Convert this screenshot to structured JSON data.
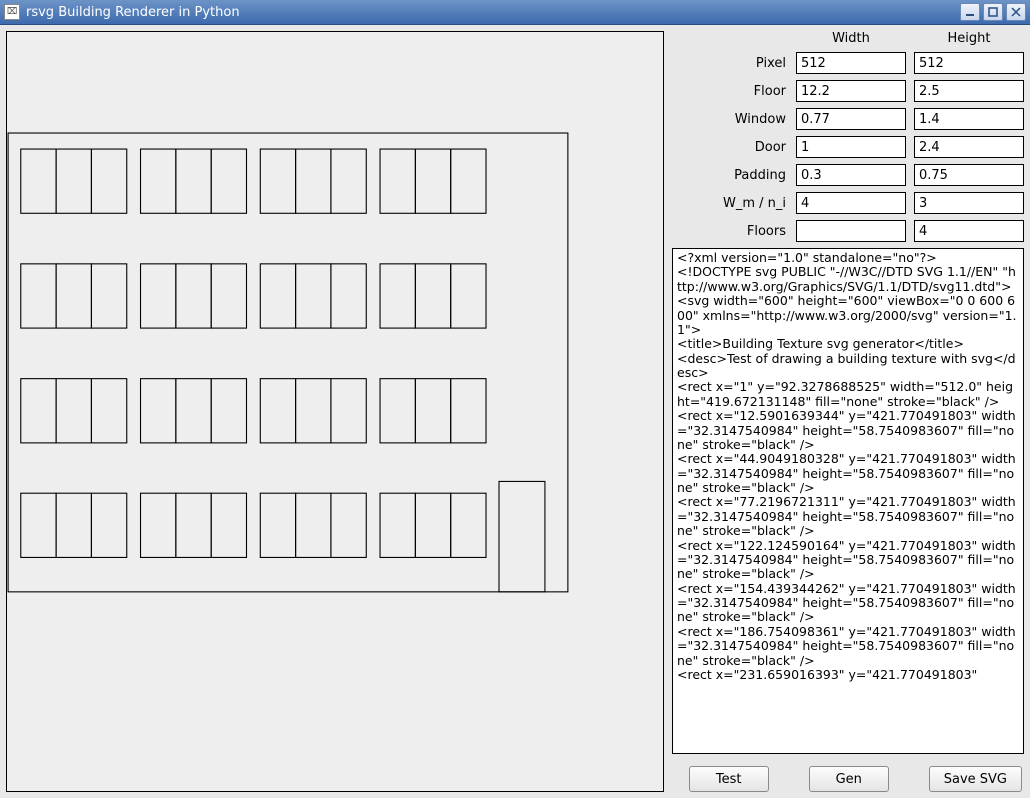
{
  "window": {
    "title": "rsvg Building Renderer in Python"
  },
  "columns": {
    "width_label": "Width",
    "height_label": "Height"
  },
  "params": {
    "pixel": {
      "label": "Pixel",
      "width": "512",
      "height": "512"
    },
    "floor": {
      "label": "Floor",
      "width": "12.2",
      "height": "2.5"
    },
    "window": {
      "label": "Window",
      "width": "0.77",
      "height": "1.4"
    },
    "door": {
      "label": "Door",
      "width": "1",
      "height": "2.4"
    },
    "padding": {
      "label": "Padding",
      "width": "0.3",
      "height": "0.75"
    },
    "wm_ni": {
      "label": "W_m / n_i",
      "width": "4",
      "height": "3"
    },
    "floors": {
      "label": "Floors",
      "width": "",
      "height": "4"
    }
  },
  "svg_source": "<?xml version=\"1.0\" standalone=\"no\"?>\n<!DOCTYPE svg PUBLIC \"-//W3C//DTD SVG 1.1//EN\" \"http://www.w3.org/Graphics/SVG/1.1/DTD/svg11.dtd\">\n<svg width=\"600\" height=\"600\" viewBox=\"0 0 600 600\" xmlns=\"http://www.w3.org/2000/svg\" version=\"1.1\">\n<title>Building Texture svg generator</title>\n<desc>Test of drawing a building texture with svg</desc>\n<rect x=\"1\" y=\"92.3278688525\" width=\"512.0\" height=\"419.672131148\" fill=\"none\" stroke=\"black\" />\n<rect x=\"12.5901639344\" y=\"421.770491803\" width=\"32.3147540984\" height=\"58.7540983607\" fill=\"none\" stroke=\"black\" />\n<rect x=\"44.9049180328\" y=\"421.770491803\" width=\"32.3147540984\" height=\"58.7540983607\" fill=\"none\" stroke=\"black\" />\n<rect x=\"77.2196721311\" y=\"421.770491803\" width=\"32.3147540984\" height=\"58.7540983607\" fill=\"none\" stroke=\"black\" />\n<rect x=\"122.124590164\" y=\"421.770491803\" width=\"32.3147540984\" height=\"58.7540983607\" fill=\"none\" stroke=\"black\" />\n<rect x=\"154.439344262\" y=\"421.770491803\" width=\"32.3147540984\" height=\"58.7540983607\" fill=\"none\" stroke=\"black\" />\n<rect x=\"186.754098361\" y=\"421.770491803\" width=\"32.3147540984\" height=\"58.7540983607\" fill=\"none\" stroke=\"black\" />\n<rect x=\"231.659016393\" y=\"421.770491803\"",
  "buttons": {
    "test": "Test",
    "gen": "Gen",
    "save": "Save SVG"
  }
}
